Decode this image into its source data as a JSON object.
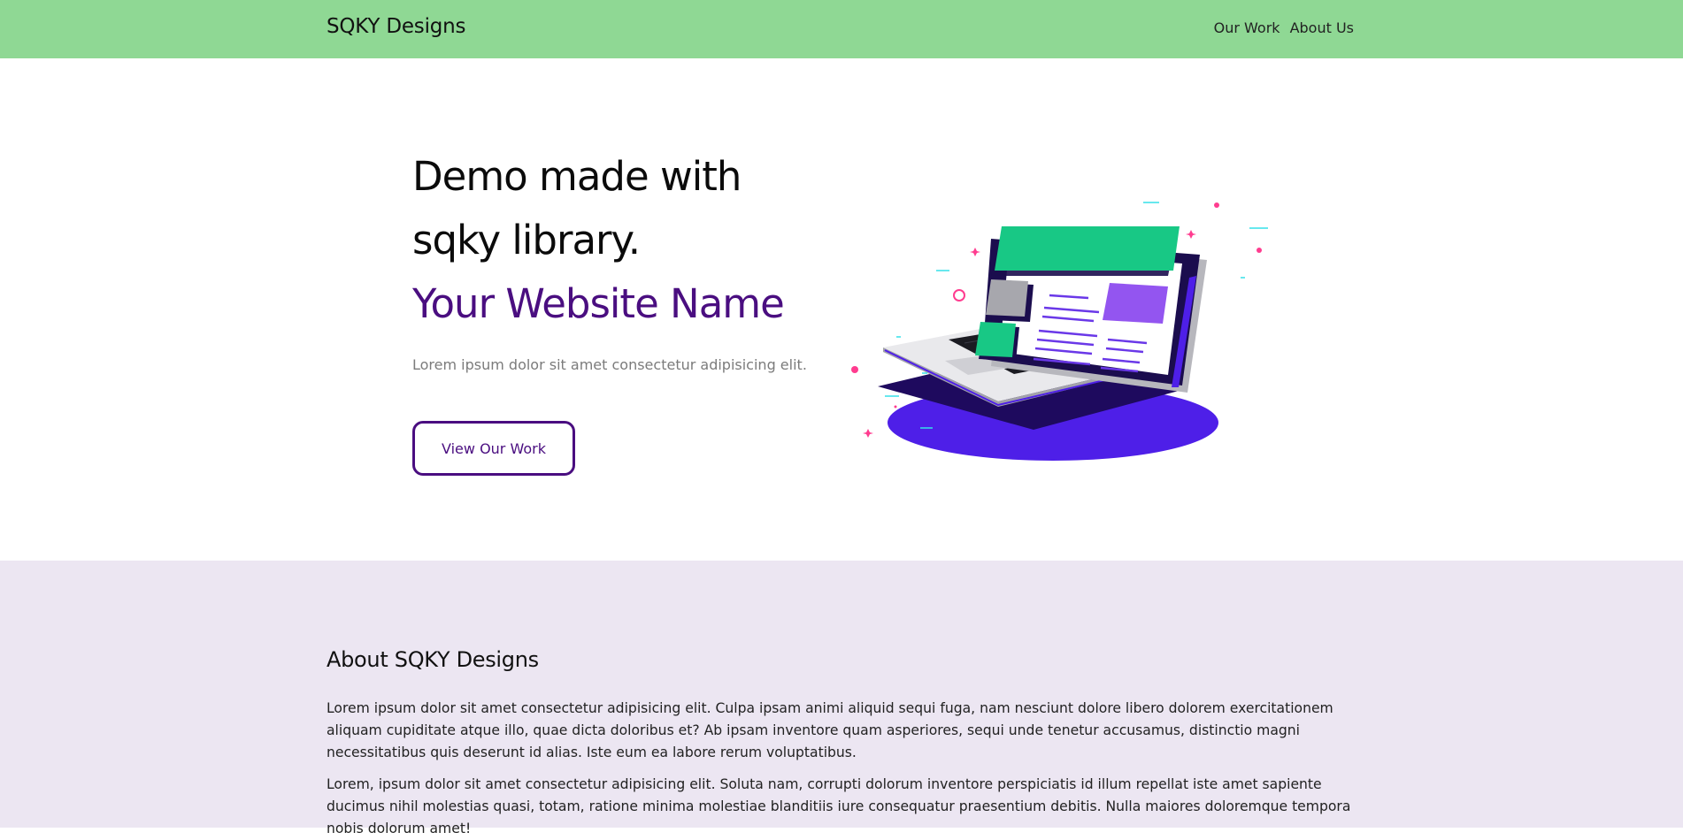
{
  "navbar": {
    "brand": "SQKY Designs",
    "links": [
      "Our Work",
      "About Us"
    ],
    "background": "#8fd894"
  },
  "hero": {
    "title_line1": "Demo made with",
    "title_line2": "sqky library.",
    "title_accent": "Your Website Name",
    "subtitle": "Lorem ipsum dolor sit amet consectetur adipisicing elit.",
    "button_label": "View Our Work",
    "accent_color": "#4a0e80",
    "illustration": "laptop-illustration"
  },
  "about": {
    "heading": "About SQKY Designs",
    "paragraphs": [
      "Lorem ipsum dolor sit amet consectetur adipisicing elit. Culpa ipsam animi aliquid sequi fuga, nam nesciunt dolore libero dolorem exercitationem aliquam cupiditate atque illo, quae dicta doloribus et? Ab ipsam inventore quam asperiores, sequi unde tenetur accusamus, distinctio magni necessitatibus quis deserunt id alias. Iste eum ea labore rerum voluptatibus.",
      "Lorem, ipsum dolor sit amet consectetur adipisicing elit. Soluta nam, corrupti dolorum inventore perspiciatis id illum repellat iste amet sapiente ducimus nihil molestias quasi, totam, ratione minima molestiae blanditiis iure consequatur praesentium debitis. Nulla maiores doloremque tempora nobis dolorum amet!"
    ],
    "background": "#ece6f2"
  }
}
